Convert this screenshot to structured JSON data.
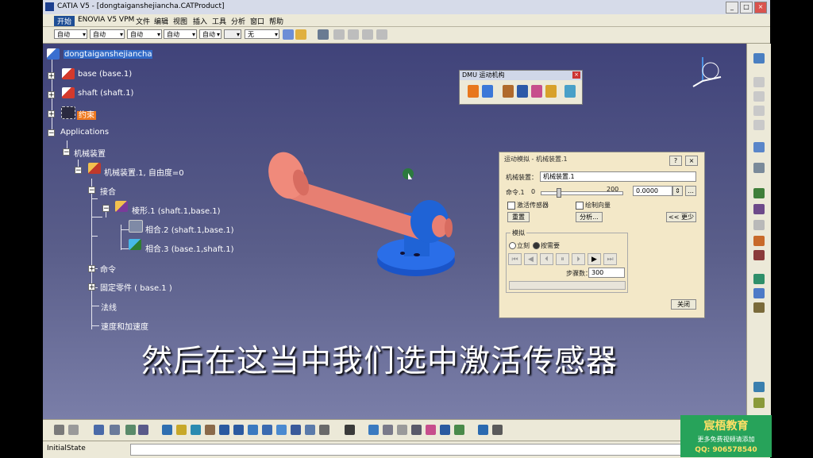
{
  "window": {
    "title": "CATIA V5 - [dongtaiganshejiancha.CATProduct]",
    "buttons": [
      "_",
      "□",
      "×"
    ]
  },
  "menu": [
    "开始",
    "ENOVIA V5 VPM",
    "文件",
    "编辑",
    "视图",
    "插入",
    "工具",
    "分析",
    "窗口",
    "帮助"
  ],
  "toolbar": {
    "combos": [
      "自动",
      "自动",
      "自动",
      "自动",
      "自动",
      "自动",
      "无"
    ]
  },
  "tree": {
    "root": "dongtaiganshejiancha",
    "base": "base (base.1)",
    "shaft": "shaft (shaft.1)",
    "constraints": "约束",
    "applications": "Applications",
    "mechanisms": "机械装置",
    "mechanism": "机械装置.1, 自由度=0",
    "joints": "接合",
    "prismatic": "棱形.1 (shaft.1,base.1)",
    "coincidence2": "相合.2 (shaft.1,base.1)",
    "coincidence3": "相合.3 (base.1,shaft.1)",
    "commands": "命令",
    "fixed": "固定零件 ( base.1 )",
    "law": "法线",
    "speed": "速度和加速度"
  },
  "dmu": {
    "title": "DMU 运动机构"
  },
  "sim": {
    "title": "运动模拟 - 机械装置.1",
    "mech_label": "机械装置：",
    "mech_value": "机械装置.1",
    "cmd_label": "命令.1",
    "cmd_min": "0",
    "cmd_max": "200",
    "cmd_value": "0.0000",
    "sensor_label": "激活传感器",
    "plot_label": "绘制向量",
    "reset_btn": "重置",
    "analyze_btn": "分析...",
    "less_btn": "<< 更少",
    "sim_group": "模拟",
    "immediate": "立刻",
    "on_request": "按需要",
    "steps_label": "步骤数：",
    "steps_value": "300",
    "close_btn": "关闭"
  },
  "subtitle": "然后在这当中我们选中激活传感器",
  "status": {
    "text": "InitialState"
  },
  "logo": {
    "line1": "宸梧教育",
    "line2": "更多免费视频请添加",
    "line3": "QQ: 906578540"
  },
  "colors": {
    "canvas_top": "#40437a",
    "part_pink": "#e77f72",
    "part_blue": "#1f63d6",
    "dialog_bg": "#f3e8c8",
    "logo_green": "#27a35a"
  }
}
